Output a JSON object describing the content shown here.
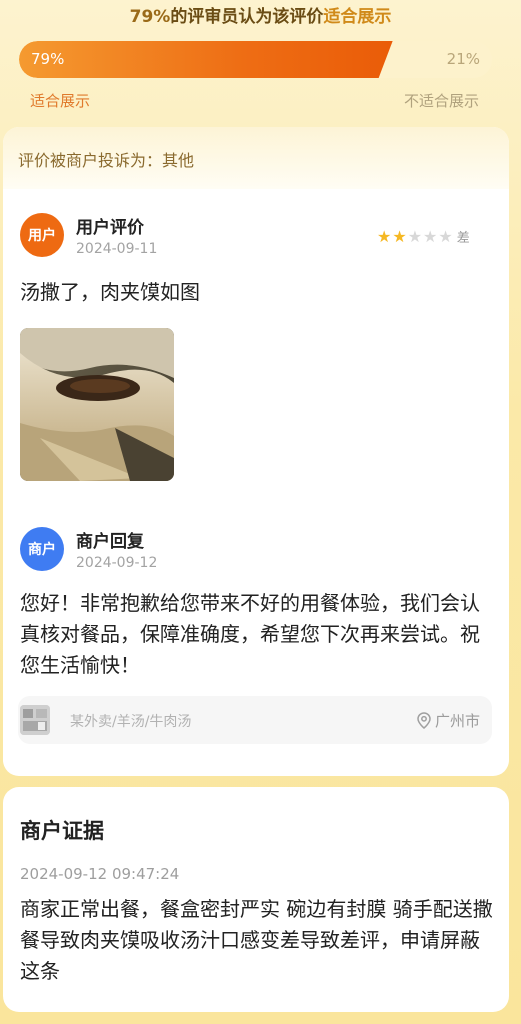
{
  "header": {
    "pct": "79%",
    "mid": "的评审员认为该评价",
    "highlight": "适合展示"
  },
  "vote": {
    "yes_fraction": 0.79,
    "yes_pct_text": "79%",
    "no_pct_text": "21%",
    "yes_label": "适合展示",
    "no_label": "不适合展示"
  },
  "complaint": {
    "text": "评价被商户投诉为：其他"
  },
  "user_review": {
    "avatar_text": "用户",
    "name": "用户评价",
    "date": "2024-09-11",
    "rating": 2,
    "rating_max": 5,
    "rating_word": "差",
    "text": "汤撒了，肉夹馍如图"
  },
  "merchant_reply": {
    "avatar_text": "商户",
    "name": "商户回复",
    "date": "2024-09-12",
    "text": "您好！非常抱歉给您带来不好的用餐体验，我们会认真核对餐品，保障准确度，希望您下次再来尝试。祝您生活愉快！"
  },
  "shop": {
    "category": "某外卖/羊汤/牛肉汤",
    "location": "广州市",
    "location_icon": "location-pin-icon"
  },
  "evidence": {
    "title": "商户证据",
    "datetime": "2024-09-12 09:47:24",
    "text": "商家正常出餐，餐盒密封严实 碗边有封膜 骑手配送撒餐导致肉夹馍吸收汤汁口感变差导致差评，申请屏蔽这条"
  },
  "colors": {
    "accent_orange": "#ee6a12",
    "merchant_blue": "#3f7cf2",
    "star_on": "#f5b824",
    "star_off": "#d8d8d8"
  }
}
